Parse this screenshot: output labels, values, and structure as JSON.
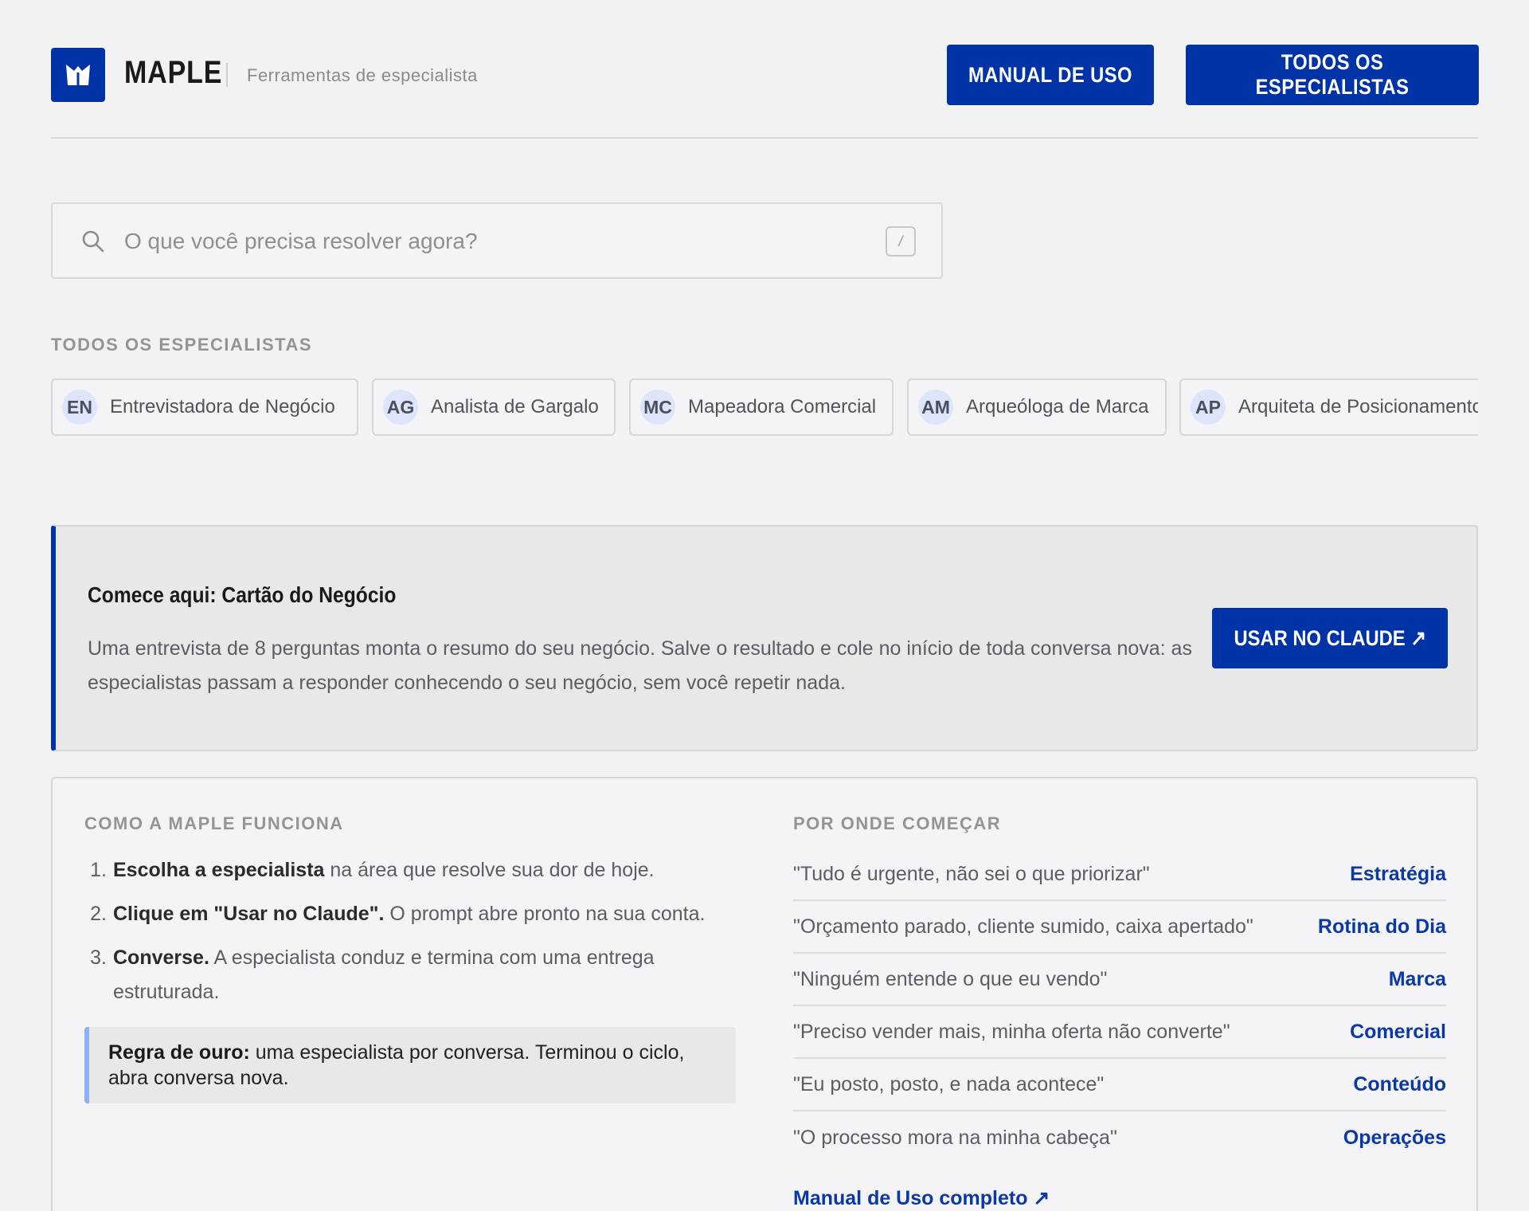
{
  "header": {
    "brand": "MAPLE",
    "tagline": "Ferramentas de especialista",
    "manual_label": "MANUAL DE USO",
    "todos_label": "TODOS OS ESPECIALISTAS"
  },
  "search": {
    "placeholder": "O que você precisa resolver agora?",
    "shortcut": "/"
  },
  "specialists": {
    "label": "TODOS OS ESPECIALISTAS",
    "items": [
      {
        "initials": "EN",
        "name": "Entrevistadora de Negócio"
      },
      {
        "initials": "AG",
        "name": "Analista de Gargalo"
      },
      {
        "initials": "MC",
        "name": "Mapeadora Comercial"
      },
      {
        "initials": "AM",
        "name": "Arqueóloga de Marca"
      },
      {
        "initials": "AP",
        "name": "Arquiteta de Posicionamento"
      }
    ]
  },
  "start_card": {
    "title": "Comece aqui: Cartão do Negócio",
    "text": "Uma entrevista de 8 perguntas monta o resumo do seu negócio. Salve o resultado e cole no início de toda conversa nova: as especialistas passam a responder conhecendo o seu negócio, sem você repetir nada.",
    "button": "USAR NO CLAUDE ↗"
  },
  "how_it_works": {
    "label": "COMO A MAPLE FUNCIONA",
    "steps": [
      {
        "n": "1.",
        "bold": "Escolha a especialista",
        "rest": " na área que resolve sua dor de hoje."
      },
      {
        "n": "2.",
        "bold": "Clique em \"Usar no Claude\".",
        "rest": " O prompt abre pronto na sua conta."
      },
      {
        "n": "3.",
        "bold": "Converse.",
        "rest": " A especialista conduz e termina com uma entrega estruturada."
      }
    ],
    "rule_bold": "Regra de ouro:",
    "rule_text": " uma especialista por conversa. Terminou o ciclo, abra conversa nova."
  },
  "where_to_start": {
    "label": "POR ONDE COMEÇAR",
    "rows": [
      {
        "quote": "\"Tudo é urgente, não sei o que priorizar\"",
        "area": "Estratégia"
      },
      {
        "quote": "\"Orçamento parado, cliente sumido, caixa apertado\"",
        "area": "Rotina do Dia"
      },
      {
        "quote": "\"Ninguém entende o que eu vendo\"",
        "area": "Marca"
      },
      {
        "quote": "\"Preciso vender mais, minha oferta não converte\"",
        "area": "Comercial"
      },
      {
        "quote": "\"Eu posto, posto, e nada acontece\"",
        "area": "Conteúdo"
      },
      {
        "quote": "\"O processo mora na minha cabeça\"",
        "area": "Operações"
      }
    ],
    "link": "Manual de Uso completo ↗"
  },
  "colors": {
    "accent": "#0033a6",
    "link": "#0b39a4",
    "background": "#f2f2f3"
  }
}
